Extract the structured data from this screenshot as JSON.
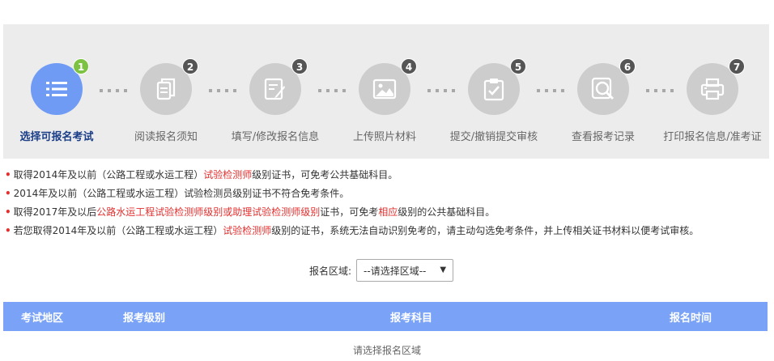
{
  "steps": [
    {
      "num": "1",
      "label": "选择可报名考试",
      "icon": "list-icon",
      "active": true
    },
    {
      "num": "2",
      "label": "阅读报名须知",
      "icon": "document-copy-icon"
    },
    {
      "num": "3",
      "label": "填写/修改报名信息",
      "icon": "edit-form-icon"
    },
    {
      "num": "4",
      "label": "上传照片材料",
      "icon": "image-icon"
    },
    {
      "num": "5",
      "label": "提交/撤销提交审核",
      "icon": "clipboard-check-icon"
    },
    {
      "num": "6",
      "label": "查看报考记录",
      "icon": "search-record-icon"
    },
    {
      "num": "7",
      "label": "打印报名信息/准考证",
      "icon": "printer-icon"
    }
  ],
  "notes": [
    {
      "parts": [
        "取得2014年及以前（公路工程或水运工程）",
        "试验检测师",
        "级别证书，可免考公共基础科目。"
      ]
    },
    {
      "parts": [
        "2014年及以前（公路工程或水运工程）试验检测员级别证书不符合免考条件。"
      ]
    },
    {
      "parts": [
        "取得2017年及以后",
        "公路水运工程试验检测师级别或助理试验检测师级别",
        "证书，可免考",
        "相应",
        "级别的公共基础科目。"
      ]
    },
    {
      "parts": [
        "若您取得2014年及以前（公路工程或水运工程）",
        "试验检测师",
        "级别的证书，系统无法自动识别免考的，请主动勾选免考条件，并上传相关证书材料以便考试审核。"
      ]
    }
  ],
  "region": {
    "label": "报名区域:",
    "value": "--请选择区域--"
  },
  "table": {
    "headers": [
      "考试地区",
      "报考级别",
      "报考科目",
      "报名时间"
    ],
    "empty": "请选择报名区域"
  },
  "colors": {
    "accent": "#6f9bf4",
    "active_badge": "#7ec243",
    "highlight": "#e3302f",
    "table_header": "#7aa3f7"
  }
}
